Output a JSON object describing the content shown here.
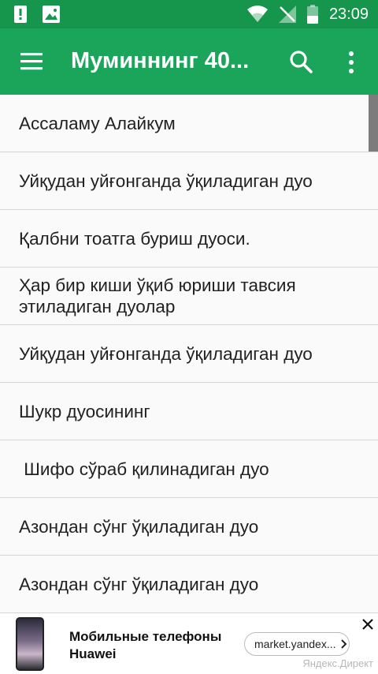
{
  "status_bar": {
    "time": "23:09"
  },
  "app_bar": {
    "title": "Муминнинг 40..."
  },
  "list_items": [
    "Ассаламу Алайкум",
    "Уйқудан уйғонганда ўқиладиган дуо",
    "Қалбни тоатга буриш дуоси.",
    "Ҳар бир киши ўқиб юриши тавсия этиладиган дуолар",
    "Уйқудан уйғонганда ўқиладиган дуо",
    "Шукр дуосининг",
    " Шифо сўраб қилинадиган дуо",
    "Азондан сўнг ўқиладиган дуо",
    "Азондан сўнг ўқиладиган дуо"
  ],
  "ad": {
    "title": "Мобильные телефоны Huawei",
    "button_label": "market.yandex...",
    "source": "Яндекс.Директ"
  },
  "colors": {
    "status_bar": "#15964c",
    "app_bar": "#1ba55a"
  }
}
